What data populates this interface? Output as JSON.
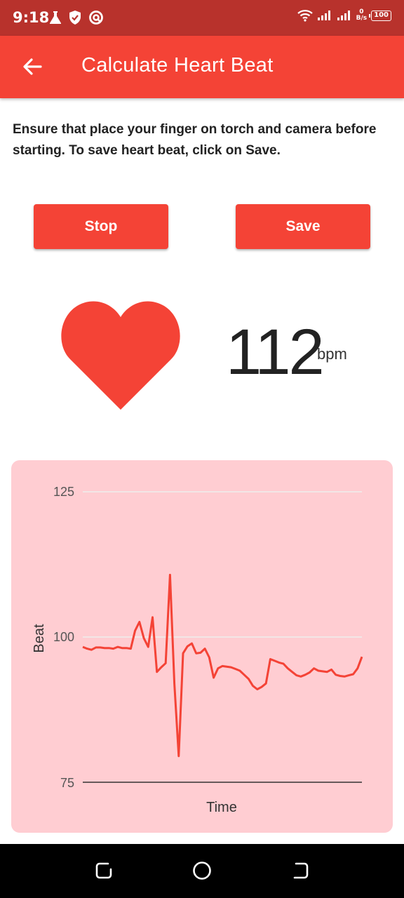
{
  "status_bar": {
    "time": "9:18",
    "net_speed_value": "0",
    "net_speed_unit": "B/s",
    "battery": "100",
    "icons": [
      "flask-icon",
      "shield-icon",
      "vpn-icon",
      "wifi-icon",
      "signal-icon",
      "signal-icon"
    ]
  },
  "app_bar": {
    "title": "Calculate Heart Beat",
    "back_icon": "arrow-back-icon"
  },
  "instructions": "Ensure that place your finger on torch and camera before starting. To save heart beat, click on Save.",
  "buttons": {
    "stop_label": "Stop",
    "save_label": "Save"
  },
  "heart_rate": {
    "value": "112",
    "unit": "bpm",
    "icon": "heart-icon"
  },
  "colors": {
    "primary": "#f44336",
    "status_bar": "#b8322c",
    "chart_background": "#ffcdd2",
    "line": "#f44336"
  },
  "chart_data": {
    "type": "line",
    "xlabel": "Time",
    "ylabel": "Beat",
    "ylim": [
      75,
      125
    ],
    "yticks": [
      "75",
      "100",
      "125"
    ],
    "grid": true,
    "series": [
      {
        "values": [
          98.3,
          98.0,
          97.8,
          98.2,
          98.2,
          98.1,
          98.1,
          98.0,
          98.3,
          98.1,
          98.1,
          98.0,
          101.1,
          102.6,
          99.8,
          98.3,
          103.4,
          94.0,
          94.8,
          95.5,
          110.7,
          92.0,
          79.5,
          97.2,
          98.4,
          98.9,
          97.2,
          97.3,
          98.0,
          96.5,
          93.0,
          94.6,
          95.0,
          94.9,
          94.8,
          94.5,
          94.2,
          93.5,
          92.8,
          91.6,
          91.0,
          91.4,
          92.0,
          96.2,
          95.9,
          95.6,
          95.4,
          94.6,
          94.0,
          93.4,
          93.2,
          93.5,
          93.9,
          94.6,
          94.2,
          94.1,
          94.0,
          94.4,
          93.5,
          93.3,
          93.2,
          93.4,
          93.6,
          94.6,
          96.6
        ]
      }
    ]
  },
  "nav_bar": {
    "icons": [
      "recent-apps-icon",
      "home-icon",
      "back-nav-icon"
    ]
  }
}
